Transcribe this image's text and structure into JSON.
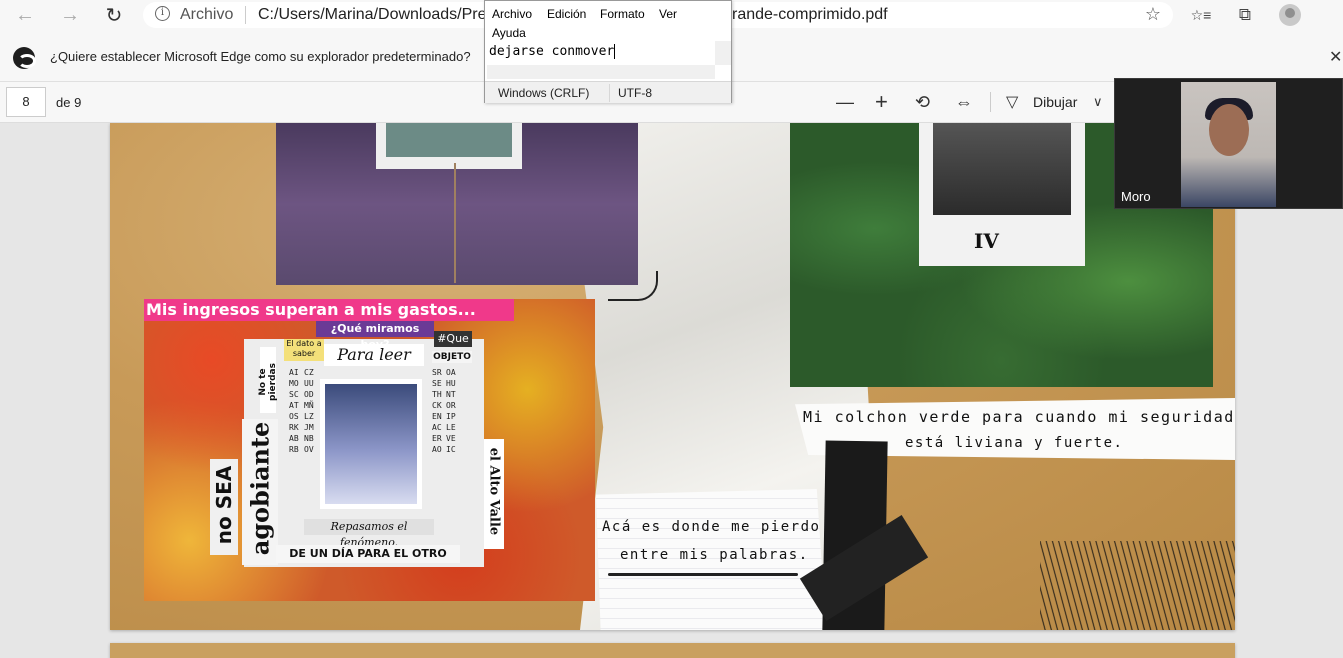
{
  "browser": {
    "back_label": "←",
    "forward_label": "→",
    "refresh_label": "↻",
    "address": {
      "scheme_label": "Archivo",
      "url_left": "C:/Users/Marina/Downloads/Pre",
      "url_right": "rande-comprimido.pdf",
      "info_glyph": "i",
      "star_glyph": "☆"
    },
    "toolbar_glyphs": {
      "favorites": "☆≡",
      "collections": "⧉"
    }
  },
  "default_bar": {
    "message": "¿Quiere establecer Microsoft Edge como su explorador predeterminado?",
    "close_glyph": "✕"
  },
  "pdf_toolbar": {
    "page_current": "8",
    "page_total": "de 9",
    "zoom_out_glyph": "—",
    "zoom_in_glyph": "+",
    "rotate_glyph": "⟲",
    "fit_glyph": "⇔",
    "draw_label": "Dibujar",
    "draw_dropdown_glyph": "∨"
  },
  "notepad": {
    "menu": [
      "Archivo",
      "Edición",
      "Formato",
      "Ver",
      "Ayuda"
    ],
    "text": "dejarse conmover",
    "status_eol": "Windows (CRLF)",
    "status_encoding": "UTF-8"
  },
  "document": {
    "collage_banner": "Mis ingresos superan a mis gastos...",
    "clip_que": "¿Qué miramos hoy?",
    "clip_para": "Para leer",
    "clip_hash": "#Que",
    "clip_objeto": "OBJETO",
    "clip_dato": "El dato a saber",
    "clip_no_pierdas": "No te pierdas",
    "clip_no_sea": "no SEA",
    "clip_agobiante": "agobiante",
    "clip_rep": "Repasamos el fenómeno.",
    "clip_dia": "DE UN DÍA PARA EL OTRO",
    "clip_alto": "el Alto Valle",
    "wordsearch": [
      "AIMOSCATOSRKABRB",
      "CZUUODMÑLZJMNBOV",
      "SRSETHCKENACERAO",
      "OAHUNTORIPLEVEIC"
    ],
    "polaroid_label": "IV",
    "note_right_line1": "Mi colchon verde para cuando mi seguridad",
    "note_right_line2": "está liviana y fuerte.",
    "note_left_line1": "Acá es donde me pierdo",
    "note_left_line2": "entre mis palabras."
  },
  "call": {
    "participant_name": "Moro"
  }
}
